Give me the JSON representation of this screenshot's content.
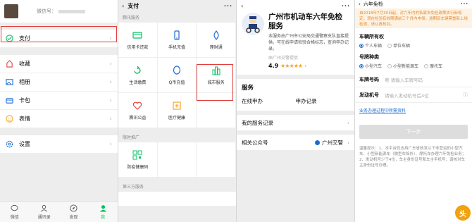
{
  "me_page": {
    "wechat_id_label": "微信号：",
    "items": [
      {
        "label": "支付",
        "icon": "pay-icon"
      },
      {
        "label": "收藏",
        "icon": "favorites-icon"
      },
      {
        "label": "相册",
        "icon": "album-icon"
      },
      {
        "label": "卡包",
        "icon": "cards-icon"
      },
      {
        "label": "表情",
        "icon": "sticker-icon"
      },
      {
        "label": "设置",
        "icon": "settings-icon"
      }
    ],
    "tabs": [
      {
        "label": "微信",
        "icon": "chat-icon"
      },
      {
        "label": "通讯录",
        "icon": "contacts-icon"
      },
      {
        "label": "发现",
        "icon": "discover-icon"
      },
      {
        "label": "我",
        "icon": "me-icon"
      }
    ]
  },
  "pay_page": {
    "title": "支付",
    "section1": "腾讯服务",
    "services": [
      {
        "label": "信用卡还款",
        "icon": "credit-card-icon"
      },
      {
        "label": "手机充值",
        "icon": "phone-topup-icon"
      },
      {
        "label": "理财通",
        "icon": "wealth-icon"
      },
      {
        "label": "生活缴费",
        "icon": "utilities-icon"
      },
      {
        "label": "Q币充值",
        "icon": "qcoin-icon"
      },
      {
        "label": "城市服务",
        "icon": "city-service-icon"
      },
      {
        "label": "腾讯公益",
        "icon": "charity-icon"
      },
      {
        "label": "医疗健康",
        "icon": "medical-icon"
      }
    ],
    "section2": "限时推广",
    "promo": [
      {
        "label": "防疫健康码",
        "icon": "health-code-icon"
      }
    ],
    "section3": "第三方服务"
  },
  "service_page": {
    "title": "广州市机动车六年免检服务",
    "desc": "本服务由广州市公安局交通警察支队直接提供。可在线申请检验合格标志，查询申办记录。",
    "source": "由广州交警提供",
    "rating": "4.9",
    "stars": "★★★★★",
    "box_title": "服务",
    "actions": [
      "在线申办",
      "申办记录"
    ],
    "my_records": "我的服务记录",
    "related_label": "相关公众号",
    "related_value": "广州交警"
  },
  "form_page": {
    "title": "六年免检",
    "notice": "自2018年7月30日起，对六年内的私家车免检政策执行新规定，须在检验有效期满前三个月内申领，逾期后车辆需重新上线检测，请认真核对。",
    "owner_label": "车辆所有权",
    "owner_options": [
      "个人车辆",
      "单位车辆"
    ],
    "plate_type_label": "号牌种类",
    "plate_types": [
      "小型汽车",
      "小型新能源车",
      "摩托车"
    ],
    "plate_no_label": "车牌号码",
    "plate_no_placeholder": "粤 请输入车牌号码",
    "engine_label": "发动机号",
    "engine_placeholder": "请输入发动机号后4位",
    "link": "业务办理过程中所需资料",
    "next_button": "下一步",
    "tip": "温馨提示：1、本平台仅支持广东省核发以下非营运的小型汽车、小型新能源车（微型车除外）、摩托车办理六年免检业务；2、发动机号少于4位，车主身份证号和车主手机号，请核对车主身份证号办理。",
    "watermark": "头"
  },
  "colors": {
    "green": "#07c160",
    "blue": "#1a6bd3",
    "orange": "#e8892f",
    "highlight": "#e03c3c"
  }
}
